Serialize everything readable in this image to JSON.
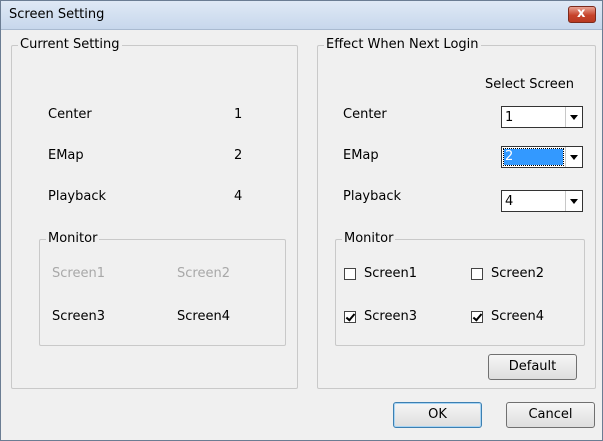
{
  "window": {
    "title": "Screen Setting",
    "close_glyph": "x",
    "close_icon": "close-icon"
  },
  "current": {
    "legend": "Current Setting",
    "rows": [
      {
        "label": "Center",
        "value": "1"
      },
      {
        "label": "EMap",
        "value": "2"
      },
      {
        "label": "Playback",
        "value": "4"
      }
    ],
    "monitor": {
      "legend": "Monitor",
      "screens": [
        {
          "label": "Screen1",
          "enabled": false
        },
        {
          "label": "Screen2",
          "enabled": false
        },
        {
          "label": "Screen3",
          "enabled": true
        },
        {
          "label": "Screen4",
          "enabled": true
        }
      ]
    }
  },
  "next": {
    "legend": "Effect When Next Login",
    "select_header": "Select Screen",
    "rows": [
      {
        "label": "Center",
        "value": "1"
      },
      {
        "label": "EMap",
        "value": "2"
      },
      {
        "label": "Playback",
        "value": "4"
      }
    ],
    "monitor": {
      "legend": "Monitor",
      "screens": [
        {
          "label": "Screen1",
          "checked": false
        },
        {
          "label": "Screen2",
          "checked": false
        },
        {
          "label": "Screen3",
          "checked": true
        },
        {
          "label": "Screen4",
          "checked": true
        }
      ]
    },
    "default_label": "Default"
  },
  "buttons": {
    "ok": "OK",
    "cancel": "Cancel"
  },
  "colors": {
    "selection": "#3399ff",
    "disabled_text": "#a8a8a8",
    "close_button": "#c7432b"
  }
}
